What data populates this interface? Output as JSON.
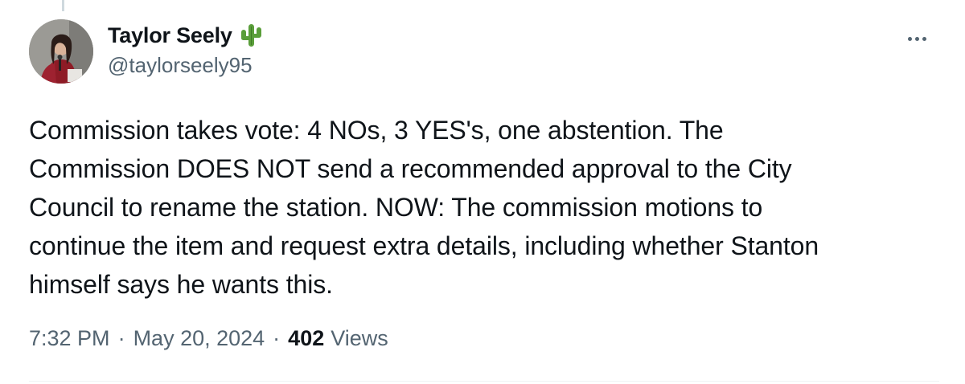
{
  "author": {
    "display_name": "Taylor Seely",
    "badge_icon": "cactus-icon",
    "handle": "@taylorseely95"
  },
  "tweet": {
    "text_lines": [
      "Commission takes vote: 4 NOs, 3 YES's, one abstention. The",
      "Commission DOES NOT send a recommended approval to the City",
      "Council to rename the station. NOW: The commission motions to",
      "continue the item and request extra details, including whether Stanton",
      "himself says he wants this."
    ]
  },
  "meta": {
    "time": "7:32 PM",
    "separator": "·",
    "date": "May 20, 2024",
    "views_count": "402",
    "views_label": "Views"
  },
  "colors": {
    "text": "#0f1419",
    "secondary": "#536471",
    "cactus": "#5a9e3a"
  }
}
